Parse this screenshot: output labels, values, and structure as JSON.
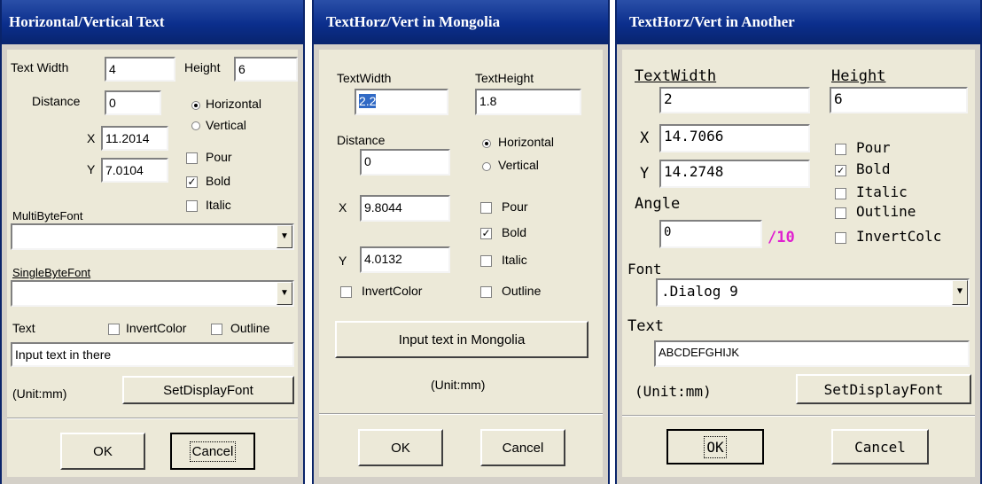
{
  "d1": {
    "title": "Horizontal/Vertical Text",
    "text_width_label": "Text Width",
    "text_width": "4",
    "height_label": "Height",
    "height": "6",
    "distance_label": "Distance",
    "distance": "0",
    "horizontal": "Horizontal",
    "vertical": "Vertical",
    "x_label": "X",
    "x": "11.2014",
    "y_label": "Y",
    "y": "7.0104",
    "pour": "Pour",
    "bold": "Bold",
    "italic": "Italic",
    "multibyte_label": "MultiByteFont",
    "multibyte_value": "",
    "singlebyte_label": "SingleByteFont",
    "singlebyte_value": "",
    "text_label": "Text",
    "invert": "InvertColor",
    "outline": "Outline",
    "text_value": "Input text in there",
    "unit": "(Unit:mm)",
    "set_font": "SetDisplayFont",
    "ok": "OK",
    "cancel": "Cancel"
  },
  "d2": {
    "title": "TextHorz/Vert in Mongolia",
    "text_width_label": "TextWidth",
    "text_width": "2.2",
    "text_height_label": "TextHeight",
    "text_height": "1.8",
    "distance_label": "Distance",
    "distance": "0",
    "horizontal": "Horizontal",
    "vertical": "Vertical",
    "x_label": "X",
    "x": "9.8044",
    "y_label": "Y",
    "y": "4.0132",
    "pour": "Pour",
    "bold": "Bold",
    "italic": "Italic",
    "invert": "InvertColor",
    "outline": "Outline",
    "input_btn": "Input text in Mongolia",
    "unit": "(Unit:mm)",
    "ok": "OK",
    "cancel": "Cancel"
  },
  "d3": {
    "title": "TextHorz/Vert in Another",
    "text_width_label": "TextWidth",
    "text_width": "2",
    "height_label": "Height",
    "height": "6",
    "x_label": "X",
    "x": "14.7066",
    "y_label": "Y",
    "y": "14.2748",
    "angle_label": "Angle",
    "angle": "0",
    "angle_unit": "/10",
    "pour": "Pour",
    "bold": "Bold",
    "italic": "Italic",
    "outline": "Outline",
    "invert": "InvertColc",
    "font_label": "Font",
    "font_value": ".Dialog 9",
    "text_label": "Text",
    "text_value": "ABCDEFGHIJK",
    "unit": "(Unit:mm)",
    "set_font": "SetDisplayFont",
    "ok": "OK",
    "cancel": "Cancel"
  },
  "colors": {
    "title_bar": "#0b2e8c",
    "face": "#ece9d8",
    "angle_unit": "#e020d0",
    "selection": "#316ac5"
  },
  "icons": {
    "dropdown": "chevron-down-icon",
    "checkmark": "check-icon"
  }
}
